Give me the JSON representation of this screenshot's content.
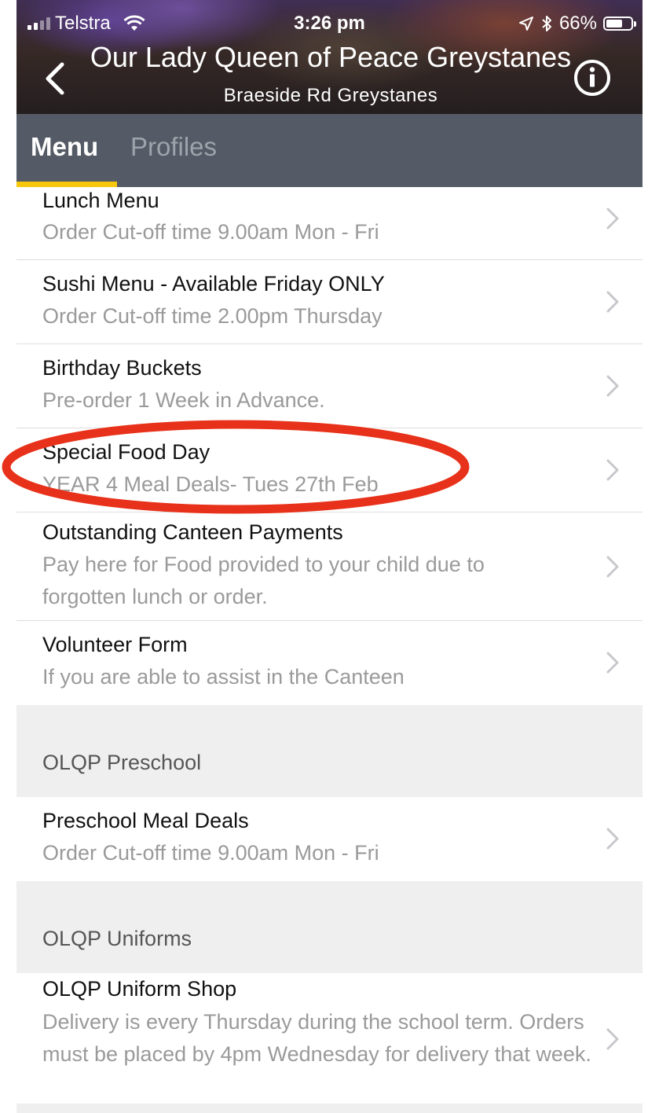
{
  "status_bar": {
    "carrier": "Telstra",
    "time": "3:26 pm",
    "battery": "66%",
    "battery_level": 0.66,
    "icons": [
      "signal-icon",
      "wifi-icon",
      "location-arrow-icon",
      "bluetooth-icon",
      "battery-icon"
    ]
  },
  "nav": {
    "title": "Our Lady Queen of Peace Greystanes",
    "subtitle": "Braeside Rd  Greystanes",
    "back_icon": "chevron-left-icon",
    "info_icon": "info-icon"
  },
  "tabs": {
    "menu": "Menu",
    "profiles": "Profiles",
    "active": "Menu",
    "indicator_color": "#f6c70b",
    "bar_color": "#555b66"
  },
  "items": [
    {
      "title": "Lunch Menu",
      "subtitle": "Order Cut-off  time 9.00am Mon - Fri"
    },
    {
      "title": "Sushi Menu - Available Friday ONLY",
      "subtitle": "Order Cut-off time 2.00pm Thursday"
    },
    {
      "title": "Birthday Buckets",
      "subtitle": "Pre-order 1 Week in Advance."
    },
    {
      "title": "Special Food Day",
      "subtitle": "YEAR 4 Meal Deals- Tues 27th Feb"
    },
    {
      "title": "Outstanding Canteen Payments",
      "subtitle": "Pay here for Food provided to your child due to forgotten lunch or order."
    },
    {
      "title": "Volunteer Form",
      "subtitle": "If you are able to assist in the Canteen"
    }
  ],
  "sections": [
    {
      "label": "OLQP Preschool",
      "items": [
        {
          "title": "Preschool Meal Deals",
          "subtitle": "Order Cut-off  time 9.00am Mon - Fri"
        }
      ]
    },
    {
      "label": "OLQP Uniforms",
      "items": [
        {
          "title": "OLQP Uniform Shop",
          "subtitle": "Delivery is every Thursday during the school term. Orders must be placed by 4pm Wednesday for delivery that week."
        }
      ]
    }
  ],
  "annotation": {
    "shape": "ellipse",
    "color": "#e8311a",
    "target": "Special Food Day"
  }
}
